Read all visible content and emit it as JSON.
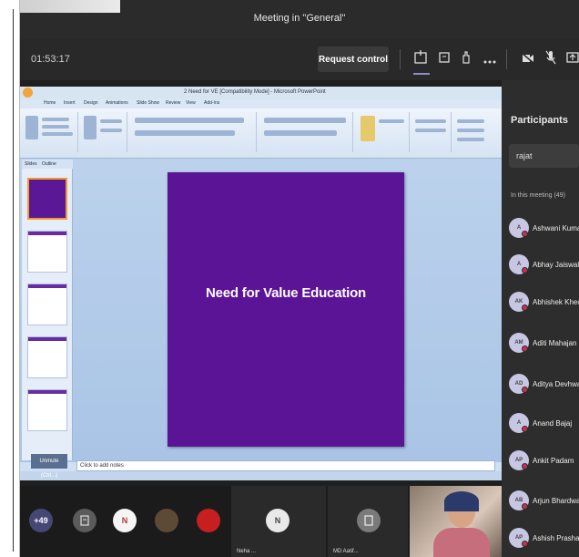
{
  "window": {
    "title": "Meeting in \"General\""
  },
  "call_bar": {
    "timer": "01:53:17",
    "request_control": "Request control",
    "icons": [
      "layout-icon",
      "chat-icon",
      "raise-hand-icon",
      "more-icon",
      "camera-icon",
      "mic-icon",
      "share-icon"
    ]
  },
  "powerpoint": {
    "title": "2 Need for VE [Compatibility Mode] - Microsoft PowerPoint",
    "tabs": [
      "Home",
      "Insert",
      "Design",
      "Animations",
      "Slide Show",
      "Review",
      "View",
      "Add-Ins"
    ],
    "thumb_tabs": [
      "Slides",
      "Outline"
    ],
    "slide_title": "Need for Value Education",
    "notes_placeholder": "Click to add notes",
    "unmute_label": "Unmute (Ctrl...)"
  },
  "participants": {
    "title": "Participants",
    "search_value": "rajat",
    "in_meeting_label": "In this meeting (49)",
    "people": [
      {
        "initials": "A",
        "name": "Ashwani Kumar"
      },
      {
        "initials": "A",
        "name": "Abhay Jaiswal"
      },
      {
        "initials": "AK",
        "name": "Abhishek Khedak"
      },
      {
        "initials": "AM",
        "name": "Aditi Mahajan"
      },
      {
        "initials": "AD",
        "name": "Aditya Devhwal"
      },
      {
        "initials": "A",
        "name": "Anand Bajaj"
      },
      {
        "initials": "AP",
        "name": "Ankit Padam"
      },
      {
        "initials": "AB",
        "name": "Arjun Bhardwaj"
      },
      {
        "initials": "AP",
        "name": "Ashish Prashar"
      }
    ]
  },
  "bottom_strip": {
    "overflow_count": "+49",
    "tiles": [
      {
        "label": "N",
        "color": "#f5f5f5",
        "text_color": "#b33",
        "name": ""
      },
      {
        "label": "N",
        "color": "#e9e9e9",
        "text_color": "#444",
        "name": "Neha ..."
      },
      {
        "label": "",
        "color": "#7a7a7a",
        "text_color": "#fff",
        "name": "MD Aatif..."
      }
    ]
  },
  "colors": {
    "slide_bg": "#5b1496",
    "teams_bg": "#1f1f1f",
    "accent": "#6264a7",
    "mute_red": "#c4314b"
  }
}
